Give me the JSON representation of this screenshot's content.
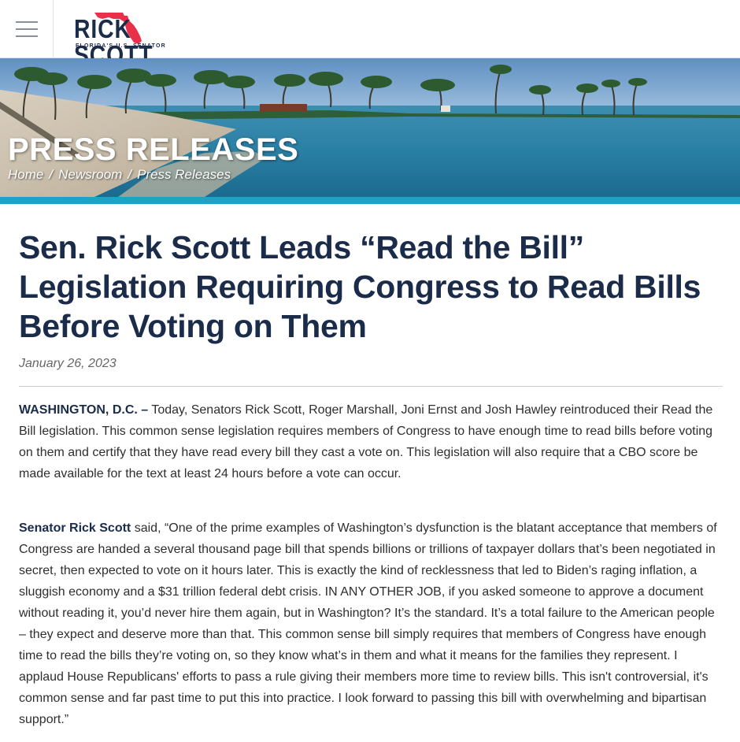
{
  "header": {
    "logo_name_left": "RICK",
    "logo_name_right": "SCOTT",
    "logo_tagline": "FLORIDA'S U.S. SENATOR"
  },
  "hero": {
    "title": "PRESS RELEASES",
    "breadcrumb": [
      "Home",
      "Newsroom",
      "Press Releases"
    ],
    "breadcrumb_separator": "/"
  },
  "article": {
    "title": "Sen. Rick Scott Leads “Read the Bill” Legislation Requiring Congress to Read Bills Before Voting on Them",
    "date": "January 26, 2023",
    "p1_lead": "WASHINGTON, D.C. –",
    "p1_text": " Today, Senators Rick Scott, Roger Marshall, Joni Ernst and Josh Hawley reintroduced their Read the Bill legislation. This common sense legislation requires members of Congress to have enough time to read bills before voting on them and certify that they have read every bill they cast a vote on. This legislation will also require that a CBO score be made available for the text at least 24 hours before a vote can occur.",
    "p2_lead": "Senator Rick Scott",
    "p2_text": " said, “One of the prime examples of Washington’s dysfunction is the blatant acceptance that members of Congress are handed a several thousand page bill that spends billions or trillions of taxpayer dollars that’s been negotiated in secret, then expected to vote on it hours later. This is exactly the kind of recklessness that led to Biden’s raging inflation, a sluggish economy and a $31 trillion federal debt crisis. IN ANY OTHER JOB, if you asked someone to approve a document without reading it, you’d never hire them again, but in Washington? It’s the standard. It’s a total failure to the American people – they expect and deserve more than that. This common sense bill simply requires that members of Congress have enough time to read the bills they’re voting on, so they know what’s in them and what it means for the families they represent. I applaud House Republicans' efforts to pass a rule giving their members more time to review bills. This isn't controversial, it's common sense and far past time to put this into practice. I look forward to passing this bill with overwhelming and bipartisan support.”"
  },
  "colors": {
    "navy": "#1b2c4a",
    "accent": "#1ea3c6",
    "florida_red": "#e8304a"
  },
  "icons": {
    "menu": "hamburger-menu-icon",
    "logo_mark": "florida-map-icon"
  }
}
